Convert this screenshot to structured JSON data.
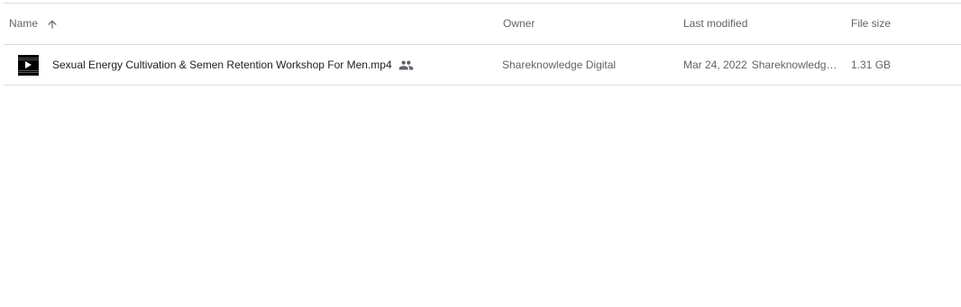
{
  "columns": {
    "name": "Name",
    "owner": "Owner",
    "last_modified": "Last modified",
    "file_size": "File size"
  },
  "sort": {
    "column": "name",
    "direction": "ascending",
    "icon": "arrow-up-icon"
  },
  "files": [
    {
      "name": "Sexual Energy Cultivation & Semen Retention Workshop For Men.mp4",
      "type_icon": "video-thumbnail-icon",
      "shared_icon": "shared-people-icon",
      "owner": "Shareknowledge Digital",
      "modified_date": "Mar 24, 2022",
      "modified_by": "Shareknowledge Digital",
      "size": "1.31 GB"
    }
  ],
  "colors": {
    "divider": "#dadce0",
    "text_primary": "#202124",
    "text_secondary": "#5f6368"
  }
}
